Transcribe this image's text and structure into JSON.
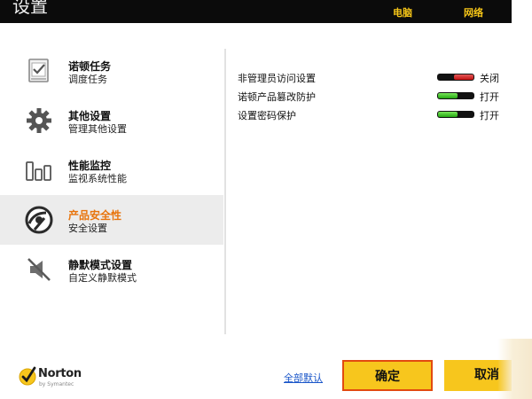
{
  "window": {
    "title": "设置",
    "top_links": [
      "电脑",
      "网络"
    ]
  },
  "sidebar": {
    "items": [
      {
        "title": "诺顿任务",
        "subtitle": "调度任务",
        "icon": "task-clipboard-icon",
        "active": false
      },
      {
        "title": "其他设置",
        "subtitle": "管理其他设置",
        "icon": "gear-icon",
        "active": false
      },
      {
        "title": "性能监控",
        "subtitle": "监视系统性能",
        "icon": "performance-bars-icon",
        "active": false
      },
      {
        "title": "产品安全性",
        "subtitle": "安全设置",
        "icon": "security-disc-icon",
        "active": true
      },
      {
        "title": "静默模式设置",
        "subtitle": "自定义静默模式",
        "icon": "mute-speaker-icon",
        "active": false
      }
    ]
  },
  "settings": {
    "rows": [
      {
        "label": "非管理员访问设置",
        "state": "关闭",
        "on": false
      },
      {
        "label": "诺顿产品篡改防护",
        "state": "打开",
        "on": true
      },
      {
        "label": "设置密码保护",
        "state": "打开",
        "on": true
      }
    ]
  },
  "footer": {
    "logo_brand": "Norton",
    "logo_sub": "by Symantec",
    "restore_defaults": "全部默认",
    "ok_label": "确定",
    "cancel_label": "取消"
  },
  "colors": {
    "accent_orange": "#e8740c",
    "button_yellow": "#f7c61d",
    "toggle_on": "#24a812",
    "toggle_off": "#c20f0f",
    "topbar": "#0b0b0b",
    "top_link": "#f5c518",
    "link_blue": "#1a56c9"
  }
}
